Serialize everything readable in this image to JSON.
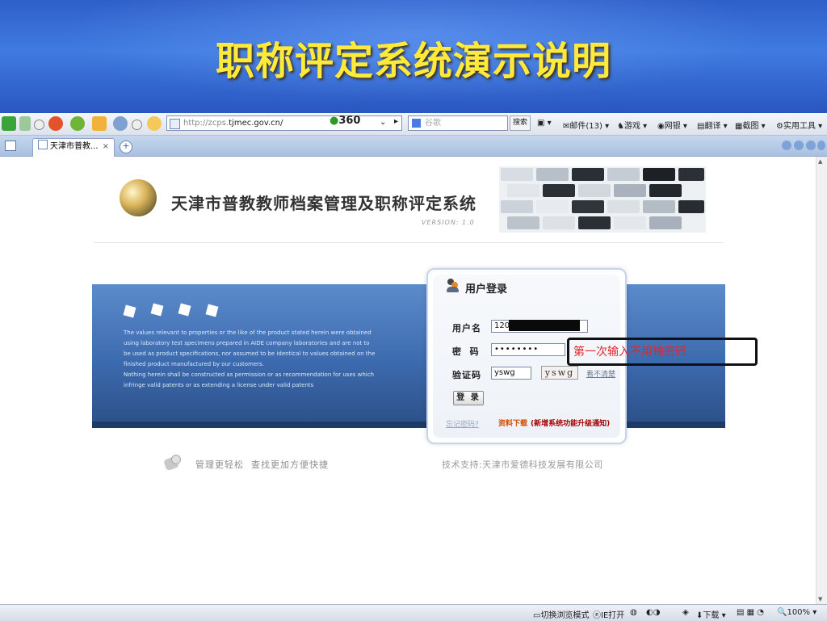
{
  "slide": {
    "title": "职称评定系统演示说明"
  },
  "browser": {
    "address": {
      "protocol": "http://zcps.",
      "host": "tjmec.gov.cn/"
    },
    "brand": "360",
    "search": {
      "placeholder": "谷歌",
      "button": "搜索"
    },
    "toolbar_items": [
      "邮件(13)",
      "游戏",
      "网银",
      "翻译",
      "截图",
      "实用工具"
    ],
    "tab": {
      "title": "天津市普教...",
      "close": "×",
      "new": "+"
    },
    "status": {
      "mode": "切换浏览模式",
      "ie": "IE打开",
      "download": "下载",
      "zoom": "100%"
    }
  },
  "page": {
    "system_title": "天津市普教教师档案管理及职称评定系统",
    "version": "VERSION: 1.0",
    "disclaimer": [
      "The values relevant to properties or the like of the product stated herein were obtained",
      "using laboratory test specimens prepared in AIDE company laboratories and are not to",
      "be used as product specifications, nor assumed to be identical to values obtained on the",
      "finished product manufactured by our customers.",
      "Nothing herein shall be constructed as permission or as recommendation for uses which",
      "infringe valid patents or as extending a license under valid patents"
    ],
    "login": {
      "title": "用户登录",
      "username_label": "用户名",
      "username_value": "1201",
      "password_label": "密  码",
      "password_value": "••••••••",
      "captcha_label": "验证码",
      "captcha_value": "yswg",
      "captcha_image_text": "yswg",
      "refresh_link": "看不清楚",
      "login_button": "登 录",
      "forgot_link": "忘记密码?",
      "download_link": "资料下载",
      "upgrade_notice": "(新增系统功能升级通知)"
    },
    "annotation": "第一次输入不用输密码",
    "footer_left": "管理更轻松  查找更加方便快捷",
    "footer_right": "技术支持:天津市爱德科技发展有限公司"
  }
}
